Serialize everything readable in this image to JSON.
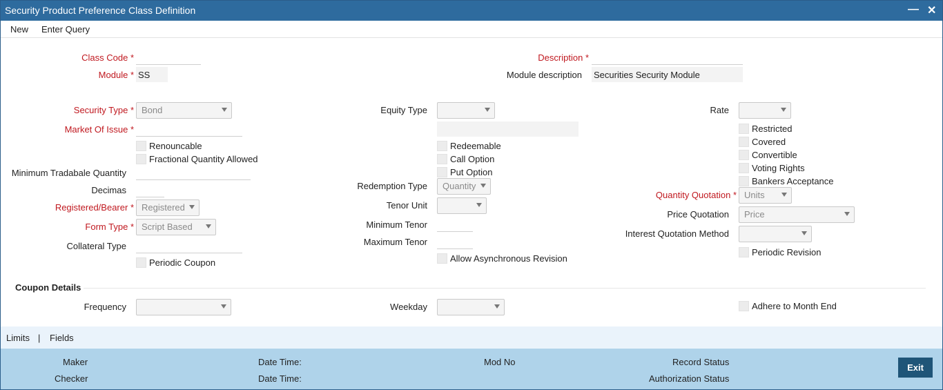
{
  "window": {
    "title": "Security Product Preference Class Definition",
    "minimize_glyph": "—",
    "close_glyph": "✕"
  },
  "menu": {
    "new": "New",
    "enter_query": "Enter Query"
  },
  "header": {
    "class_code_label": "Class Code",
    "class_code_value": "",
    "module_label": "Module",
    "module_value": "SS",
    "description_label": "Description",
    "description_value": "",
    "module_desc_label": "Module description",
    "module_desc_value": "Securities Security Module"
  },
  "left": {
    "security_type_label": "Security Type",
    "security_type_value": "Bond",
    "market_of_issue_label": "Market Of Issue",
    "market_of_issue_value": "",
    "renouncable": "Renouncable",
    "fractional_quantity": "Fractional Quantity Allowed",
    "min_tradable_qty_label": "Minimum Tradabale Quantity",
    "min_tradable_qty_value": "",
    "decimas_label": "Decimas",
    "decimas_value": "",
    "registered_bearer_label": "Registered/Bearer",
    "registered_bearer_value": "Registered",
    "form_type_label": "Form Type",
    "form_type_value": "Script Based",
    "collateral_type_label": "Collateral Type",
    "collateral_type_value": "",
    "periodic_coupon": "Periodic Coupon"
  },
  "middle": {
    "equity_type_label": "Equity Type",
    "equity_type_value": "",
    "equity_desc_value": "",
    "redeemable": "Redeemable",
    "call_option": "Call Option",
    "put_option": "Put Option",
    "redemption_type_label": "Redemption Type",
    "redemption_type_value": "Quantity",
    "tenor_unit_label": "Tenor Unit",
    "tenor_unit_value": "",
    "min_tenor_label": "Minimum Tenor",
    "min_tenor_value": "",
    "max_tenor_label": "Maximum Tenor",
    "max_tenor_value": "",
    "allow_async_revision": "Allow Asynchronous Revision"
  },
  "right": {
    "rate_label": "Rate",
    "rate_value": "",
    "restricted": "Restricted",
    "covered": "Covered",
    "convertible": "Convertible",
    "voting_rights": "Voting Rights",
    "bankers_acceptance": "Bankers Acceptance",
    "quantity_quotation_label": "Quantity Quotation",
    "quantity_quotation_value": "Units",
    "price_quotation_label": "Price Quotation",
    "price_quotation_value": "Price",
    "interest_quotation_label": "Interest Quotation Method",
    "interest_quotation_value": "",
    "periodic_revision": "Periodic Revision"
  },
  "coupon": {
    "section_title": "Coupon Details",
    "frequency_label": "Frequency",
    "frequency_value": "",
    "weekday_label": "Weekday",
    "weekday_value": "",
    "adhere_month_end": "Adhere to Month End"
  },
  "footer_links": {
    "limits": "Limits",
    "separator": "|",
    "fields": "Fields"
  },
  "audit": {
    "maker": "Maker",
    "checker": "Checker",
    "date_time_1": "Date Time:",
    "date_time_2": "Date Time:",
    "mod_no": "Mod No",
    "record_status": "Record Status",
    "authorization_status": "Authorization Status",
    "exit": "Exit"
  },
  "required_mark": "*"
}
